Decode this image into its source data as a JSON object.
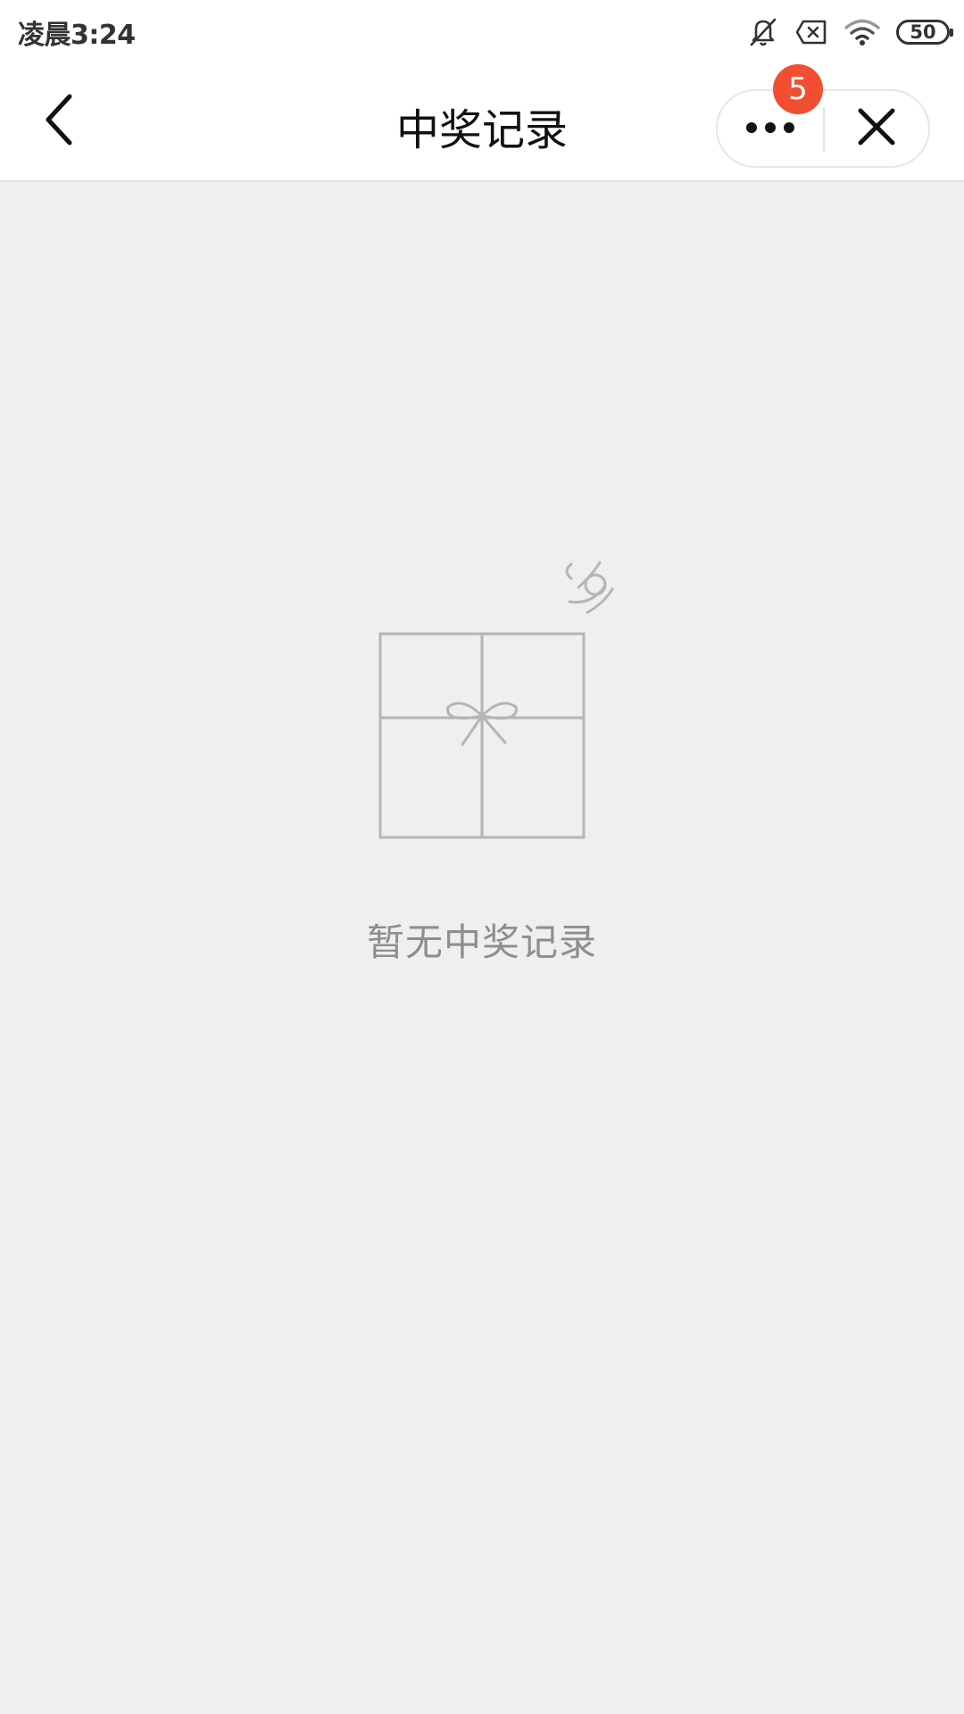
{
  "status_bar": {
    "time": "凌晨3:24",
    "battery_level": "50",
    "icons": [
      "bell-off-icon",
      "sim-disabled-icon",
      "wifi-icon",
      "battery-icon"
    ]
  },
  "nav": {
    "title": "中奖记录",
    "back_icon": "chevron-left-icon",
    "more_icon": "more-dots-icon",
    "close_icon": "close-icon",
    "badge_count": "5"
  },
  "empty_state": {
    "icon": "gift-box-icon",
    "message": "暂无中奖记录"
  },
  "colors": {
    "background": "#efefef",
    "badge": "#f24e34",
    "title_text": "#111111",
    "empty_text": "#8e8e8e",
    "illustration_stroke": "#b5b5b5"
  }
}
